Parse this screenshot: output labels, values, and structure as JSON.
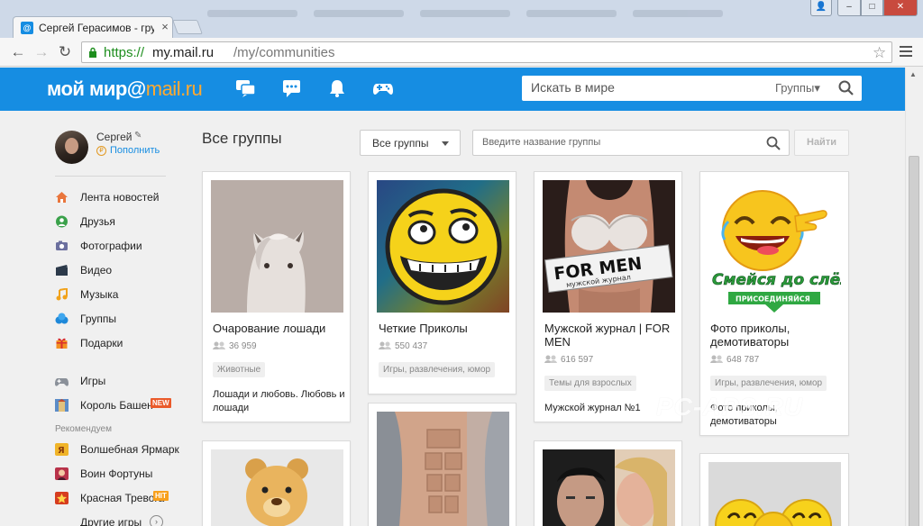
{
  "browser": {
    "tab_title": "Сергей Герасимов - груп",
    "url_scheme": "https://",
    "url_host": "my.mail.ru",
    "url_path": "/my/communities"
  },
  "header": {
    "logo_main": "мой мир@",
    "logo_mail": "mail.ru",
    "search_placeholder": "Искать в мире",
    "search_scope": "Группы▾",
    "brand_color": "#168de2"
  },
  "sidebar": {
    "user_name": "Сергей",
    "topup_label": "Пополнить",
    "nav": [
      {
        "label": "Лента новостей",
        "icon": "home-icon"
      },
      {
        "label": "Друзья",
        "icon": "friends-icon"
      },
      {
        "label": "Фотографии",
        "icon": "camera-icon"
      },
      {
        "label": "Видео",
        "icon": "film-icon"
      },
      {
        "label": "Музыка",
        "icon": "music-note-icon"
      },
      {
        "label": "Группы",
        "icon": "groups-icon"
      },
      {
        "label": "Подарки",
        "icon": "gift-icon"
      }
    ],
    "games": [
      {
        "label": "Игры",
        "icon": "gamepad-icon"
      },
      {
        "label": "Король Башен",
        "icon": "tower-game-icon",
        "badge": "NEW"
      }
    ],
    "recommended_label": "Рекомендуем",
    "recommended": [
      {
        "label": "Волшебная Ярмарка",
        "icon": "fair-game-icon"
      },
      {
        "label": "Воин Фортуны",
        "icon": "warrior-game-icon"
      },
      {
        "label": "Красная Тревога",
        "icon": "alert-game-icon",
        "badge": "HIT"
      }
    ],
    "more_games": "Другие игры"
  },
  "main": {
    "title": "Все группы",
    "filter_selected": "Все группы",
    "group_search_placeholder": "Введите название группы",
    "find_button": "Найти",
    "groups": [
      {
        "title": "Очарование лошади",
        "members": "36 959",
        "category": "Животные",
        "description": "Лошади и любовь. Любовь и лошади"
      },
      {
        "title": "Четкие Приколы",
        "members": "550 437",
        "category": "Игры, развлечения, юмор",
        "description": ""
      },
      {
        "title": "Мужской журнал | FOR MEN",
        "members": "616 597",
        "category": "Темы для взрослых",
        "description": "Мужской журнал №1"
      },
      {
        "title": "Фото приколы, демотиваторы",
        "members": "648 787",
        "category": "Игры, развлечения, юмор",
        "description": "Фото приколы, демотиваторы"
      }
    ],
    "poster_text": {
      "formen": "FOR MEN",
      "formen_sub": "мужской журнал",
      "smile_caption": "Смейся до слёз",
      "smile_join": "ПРИСОЕДИНЯЙСЯ"
    }
  },
  "watermark": "PC-APS.RU"
}
